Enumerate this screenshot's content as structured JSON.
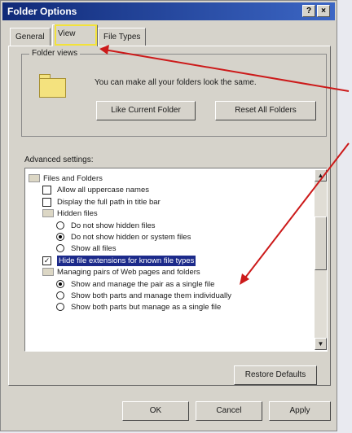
{
  "window": {
    "title": "Folder Options",
    "help_label": "?",
    "close_label": "×"
  },
  "tabs": [
    {
      "label": "General"
    },
    {
      "label": "View"
    },
    {
      "label": "File Types"
    }
  ],
  "folder_views": {
    "legend": "Folder views",
    "description": "You can make all your folders look the same.",
    "like_current_label": "Like Current Folder",
    "reset_all_label": "Reset All Folders"
  },
  "advanced": {
    "label": "Advanced settings:",
    "items": [
      {
        "text": "Files and Folders",
        "kind": "folder",
        "indent": 0,
        "checked": false
      },
      {
        "text": "Allow all uppercase names",
        "kind": "checkbox",
        "indent": 1,
        "checked": false
      },
      {
        "text": "Display the full path in title bar",
        "kind": "checkbox",
        "indent": 1,
        "checked": false
      },
      {
        "text": "Hidden files",
        "kind": "folder",
        "indent": 1,
        "checked": false
      },
      {
        "text": "Do not show hidden files",
        "kind": "radio",
        "indent": 2,
        "checked": false
      },
      {
        "text": "Do not show hidden or system files",
        "kind": "radio",
        "indent": 2,
        "checked": true
      },
      {
        "text": "Show all files",
        "kind": "radio",
        "indent": 2,
        "checked": false
      },
      {
        "text": "Hide file extensions for known file types",
        "kind": "checkbox",
        "indent": 1,
        "checked": true,
        "selected": true
      },
      {
        "text": "Managing pairs of Web pages and folders",
        "kind": "folder",
        "indent": 1,
        "checked": false
      },
      {
        "text": "Show and manage the pair as a single file",
        "kind": "radio",
        "indent": 2,
        "checked": true
      },
      {
        "text": "Show both parts and manage them individually",
        "kind": "radio",
        "indent": 2,
        "checked": false
      },
      {
        "text": "Show both parts but manage as a single file",
        "kind": "radio",
        "indent": 2,
        "checked": false
      }
    ]
  },
  "buttons": {
    "restore_defaults": "Restore Defaults",
    "ok": "OK",
    "cancel": "Cancel",
    "apply": "Apply"
  },
  "colors": {
    "title_bar": "#1c2a8a",
    "annotation_arrow": "#cc1a1a",
    "tab_highlight": "#f3e23a",
    "selection": "#1c2a8a"
  }
}
